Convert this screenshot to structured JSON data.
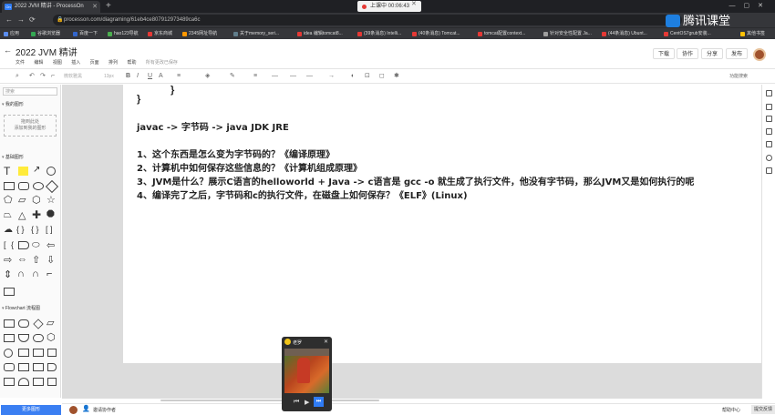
{
  "browser": {
    "tab_title": "2022 JVM 精讲 - ProcessOn",
    "tab_favicon": "On",
    "new_tab": "+",
    "recording": "上课中 00:06:43",
    "url": "processon.com/diagraming/61eb4ce807912973489ca6c",
    "brand": "腾讯课堂",
    "bookmarks": [
      "应用",
      "谷歌浏览器",
      "百度一下",
      "hao123导航",
      "京东商城",
      "2345网址导航",
      "关于memory_seri...",
      "idea 编辑tomcat8...",
      "(39条消息) Intelli...",
      "(40条消息) Tomcat...",
      "tomcat配置context...",
      "针对安全性配置 Ja...",
      "(44条消息) Ubunt...",
      "CentOS7grub安装...",
      "其他书签"
    ]
  },
  "app": {
    "title": "2022 JVM 精讲",
    "menus": [
      "文件",
      "编辑",
      "视图",
      "插入",
      "页面",
      "排列",
      "帮助"
    ],
    "saved_status": "所有更改已保存",
    "buttons": {
      "download": "下载",
      "collab": "协作",
      "share": "分享",
      "publish": "发布"
    },
    "toolbar": {
      "font": "微软雅黑",
      "size": "13px",
      "feature_search": "功能搜索"
    }
  },
  "left_panel": {
    "search_placeholder": "搜索",
    "my_shapes": "我的图形",
    "drop_hint": [
      "拖到此处",
      "添加到我的图形"
    ],
    "basic_shapes": "基础图形",
    "flowchart": "Flowchart 流程图",
    "new_graph": "更多图形"
  },
  "canvas": {
    "code_lines": [
      "}",
      "}"
    ],
    "heading": "javac -> 字节码 -> java   JDK JRE",
    "items": [
      "1、这个东西是怎么变为字节码的？《编译原理》",
      "2、计算机中如何保存这些信息的？《计算机组成原理》",
      "3、JVM是什么？展示C语言的helloworld + Java -> c语言是 gcc -o 就生成了执行文件，他没有字节码，那么JVM又是如何执行的呢",
      "4、编译完了之后，字节码和c的执行文件，在磁盘上如何保存？《ELF》(Linux)"
    ]
  },
  "statusbar": {
    "invite": "邀请协作者",
    "help": "帮助中心",
    "feedback": "提交反馈"
  },
  "video": {
    "title": "老罗"
  }
}
